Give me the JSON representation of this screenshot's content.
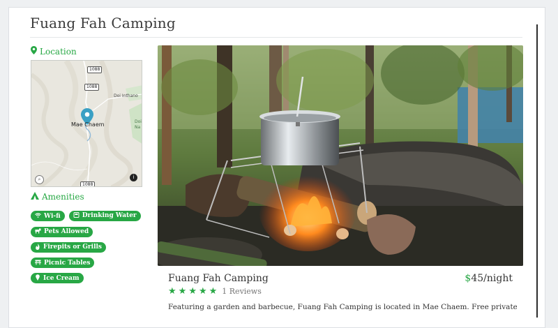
{
  "page": {
    "title": "Fuang Fah Camping"
  },
  "location": {
    "heading": "Location"
  },
  "map": {
    "roads": [
      "1088",
      "1088",
      "1088"
    ],
    "places": [
      "Mae Chaem",
      "Doi Inthano",
      "Doi",
      "Na"
    ]
  },
  "amenities": {
    "heading": "Amenities",
    "items": [
      {
        "label": "Wi-fi",
        "icon": "wifi-icon"
      },
      {
        "label": "Drinking Water",
        "icon": "water-icon"
      },
      {
        "label": "Pets Allowed",
        "icon": "paw-icon"
      },
      {
        "label": "Firepits or Grills",
        "icon": "fire-icon"
      },
      {
        "label": "Picnic Tables",
        "icon": "table-icon"
      },
      {
        "label": "Ice Cream",
        "icon": "ice-cream-icon"
      }
    ]
  },
  "listing": {
    "name": "Fuang Fah Camping",
    "price_currency": "$",
    "price_amount": "45",
    "price_unit": "/night",
    "rating": 5,
    "reviews": "1 Reviews",
    "description": "Featuring a garden and barbecue, Fuang Fah Camping is located in Mae Chaem. Free private"
  },
  "colors": {
    "accent": "#28a745",
    "title": "#3a3a3a"
  }
}
